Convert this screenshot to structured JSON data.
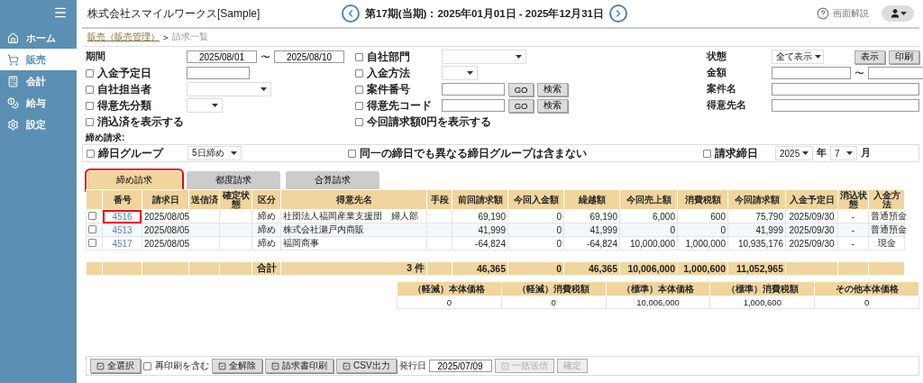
{
  "sidebar": {
    "items": [
      {
        "kind": "home",
        "label": "ホーム",
        "selected": false
      },
      {
        "kind": "cart",
        "label": "販売",
        "selected": true
      },
      {
        "kind": "calc",
        "label": "会計",
        "selected": false
      },
      {
        "kind": "bag",
        "label": "給与",
        "selected": false
      },
      {
        "kind": "gear",
        "label": "設定",
        "selected": false
      }
    ]
  },
  "header": {
    "company": "株式会社スマイルワークス[Sample]",
    "period": "第17期(当期)：2025年01月01日 - 2025年12月31日",
    "help": "画面解説"
  },
  "breadcrumb": {
    "link": "販売（販売管理）",
    "separator": ">",
    "current": "請求一覧"
  },
  "filters": {
    "left": [
      {
        "kind": "label",
        "label": "期間",
        "field": {
          "kind": "range",
          "from": "2025/08/01",
          "separator": "〜",
          "to": "2025/08/10"
        }
      },
      {
        "kind": "checkbox",
        "label": "入金予定日",
        "checked": false,
        "field": {
          "kind": "text"
        }
      },
      {
        "kind": "checkbox",
        "label": "自社担当者",
        "checked": false,
        "field": {
          "kind": "select-wide"
        }
      },
      {
        "kind": "checkbox",
        "label": "得意先分類",
        "checked": false,
        "field": {
          "kind": "select"
        }
      },
      {
        "kind": "checkbox",
        "label": "消込済を表示する",
        "checked": false
      }
    ],
    "middle": [
      {
        "kind": "checkbox",
        "label": "自社部門",
        "checked": false,
        "field": {
          "kind": "select-wide"
        }
      },
      {
        "kind": "checkbox",
        "label": "入金方法",
        "checked": false,
        "field": {
          "kind": "select"
        }
      },
      {
        "kind": "checkbox",
        "label": "案件番号",
        "checked": false,
        "field": {
          "kind": "search",
          "buttons": [
            "GO",
            "検索"
          ]
        }
      },
      {
        "kind": "checkbox",
        "label": "得意先コード",
        "checked": false,
        "field": {
          "kind": "search",
          "buttons": [
            "GO",
            "検索"
          ]
        }
      },
      {
        "kind": "checkbox",
        "label": "今回請求額0円を表示する",
        "checked": false
      }
    ],
    "right": [
      {
        "kind": "label",
        "label": "状態",
        "field": {
          "kind": "select",
          "value": "全て表示",
          "buttons": [
            "表示",
            "印刷"
          ]
        }
      },
      {
        "kind": "label",
        "label": "金額",
        "field": {
          "kind": "range",
          "separator": "〜"
        }
      },
      {
        "kind": "label",
        "label": "案件名",
        "field": {
          "kind": "text-wide"
        }
      },
      {
        "kind": "label",
        "label": "得意先名",
        "field": {
          "kind": "text-wide"
        }
      }
    ]
  },
  "closing": {
    "title": "締め請求:",
    "group": {
      "label": "締日グループ",
      "checked": false,
      "value": "5日締め"
    },
    "exclude": {
      "label": "同一の締日でも異なる締日グループは含まない",
      "checked": false
    },
    "date": {
      "label": "請求締日",
      "checked": false,
      "year": "2025",
      "year_unit": "年",
      "month": "7",
      "month_unit": "月"
    }
  },
  "tabs": [
    {
      "label": "締め請求",
      "selected": true,
      "highlighted": true
    },
    {
      "label": "都度請求",
      "selected": false,
      "highlighted": false
    },
    {
      "label": "合算請求",
      "selected": false,
      "highlighted": false
    }
  ],
  "table": {
    "columns": [
      "番号",
      "請求日",
      "送信済",
      "確定状態",
      "区分",
      "得意先名",
      "手段",
      "前回請求額",
      "今回入金額",
      "繰越額",
      "今回売上額",
      "消費税額",
      "今回請求額",
      "入金予定日",
      "消込状態",
      "入金方法"
    ],
    "rows": [
      {
        "checked": false,
        "highlighted": true,
        "cells": [
          "4516",
          "2025/08/05",
          "",
          "",
          "締め",
          "社団法人福岡産業支援団　婦人部",
          "",
          "69,190",
          "0",
          "69,190",
          "6,000",
          "600",
          "75,790",
          "2025/09/30",
          "-",
          "普通預金"
        ]
      },
      {
        "checked": false,
        "highlighted": false,
        "cells": [
          "4513",
          "2025/08/05",
          "",
          "",
          "締め",
          "株式会社瀬戸内商販",
          "",
          "41,999",
          "0",
          "41,999",
          "0",
          "0",
          "41,999",
          "2025/09/30",
          "-",
          "普通預金"
        ]
      },
      {
        "checked": false,
        "highlighted": false,
        "cells": [
          "4517",
          "2025/08/05",
          "",
          "",
          "締め",
          "福岡商事",
          "",
          "-64,824",
          "0",
          "-64,824",
          "10,000,000",
          "1,000,000",
          "10,935,176",
          "2025/09/30",
          "-",
          "現金"
        ]
      }
    ],
    "totals": {
      "label": "合計",
      "count": "3 件",
      "values": [
        "46,365",
        "0",
        "46,365",
        "10,006,000",
        "1,000,600",
        "11,052,965"
      ]
    }
  },
  "tax_summary": {
    "columns": [
      "（軽減）本体価格",
      "（軽減）消費税額",
      "（標準）本体価格",
      "（標準）消費税額",
      "その他本体価格"
    ],
    "values": [
      "0",
      "0",
      "10,006,000",
      "1,000,600",
      "0"
    ]
  },
  "footer": {
    "select_all": "全選択",
    "reprint": {
      "label": "再印刷を含む",
      "checked": false
    },
    "buttons": [
      {
        "label": "全解除",
        "disabled": false
      },
      {
        "label": "請求書印刷",
        "disabled": false
      },
      {
        "label": "CSV出力",
        "disabled": false
      }
    ],
    "issue_label": "発行日",
    "issue_date": "2025/07/09",
    "actions": [
      {
        "label": "一括送信",
        "disabled": true
      },
      {
        "label": "確定",
        "disabled": true
      }
    ]
  }
}
